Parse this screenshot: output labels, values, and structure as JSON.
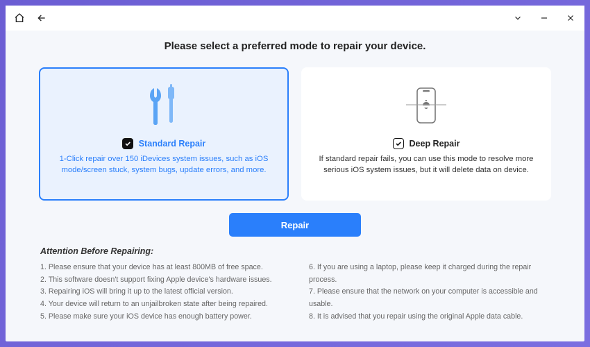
{
  "heading": "Please select a preferred mode to repair your device.",
  "cards": {
    "standard": {
      "title": "Standard Repair",
      "desc": "1-Click repair over 150 iDevices system issues, such as iOS mode/screen stuck, system bugs, update errors, and more."
    },
    "deep": {
      "title": "Deep Repair",
      "desc": "If standard repair fails, you can use this mode to resolve more serious iOS system issues, but it will delete data on device."
    }
  },
  "repair_button": "Repair",
  "attention": {
    "heading": "Attention Before Repairing:",
    "left": [
      "1. Please ensure that your device has at least 800MB of free space.",
      "2. This software doesn't support fixing Apple device's hardware issues.",
      "3. Repairing iOS will bring it up to the latest official version.",
      "4. Your device will return to an unjailbroken state after being repaired.",
      "5. Please make sure your iOS device has enough battery power."
    ],
    "right": [
      "6. If you are using a laptop, please keep it charged during the repair process.",
      "7. Please ensure that the network on your computer is accessible and usable.",
      "8. It is advised that you repair using the original Apple data cable."
    ]
  }
}
